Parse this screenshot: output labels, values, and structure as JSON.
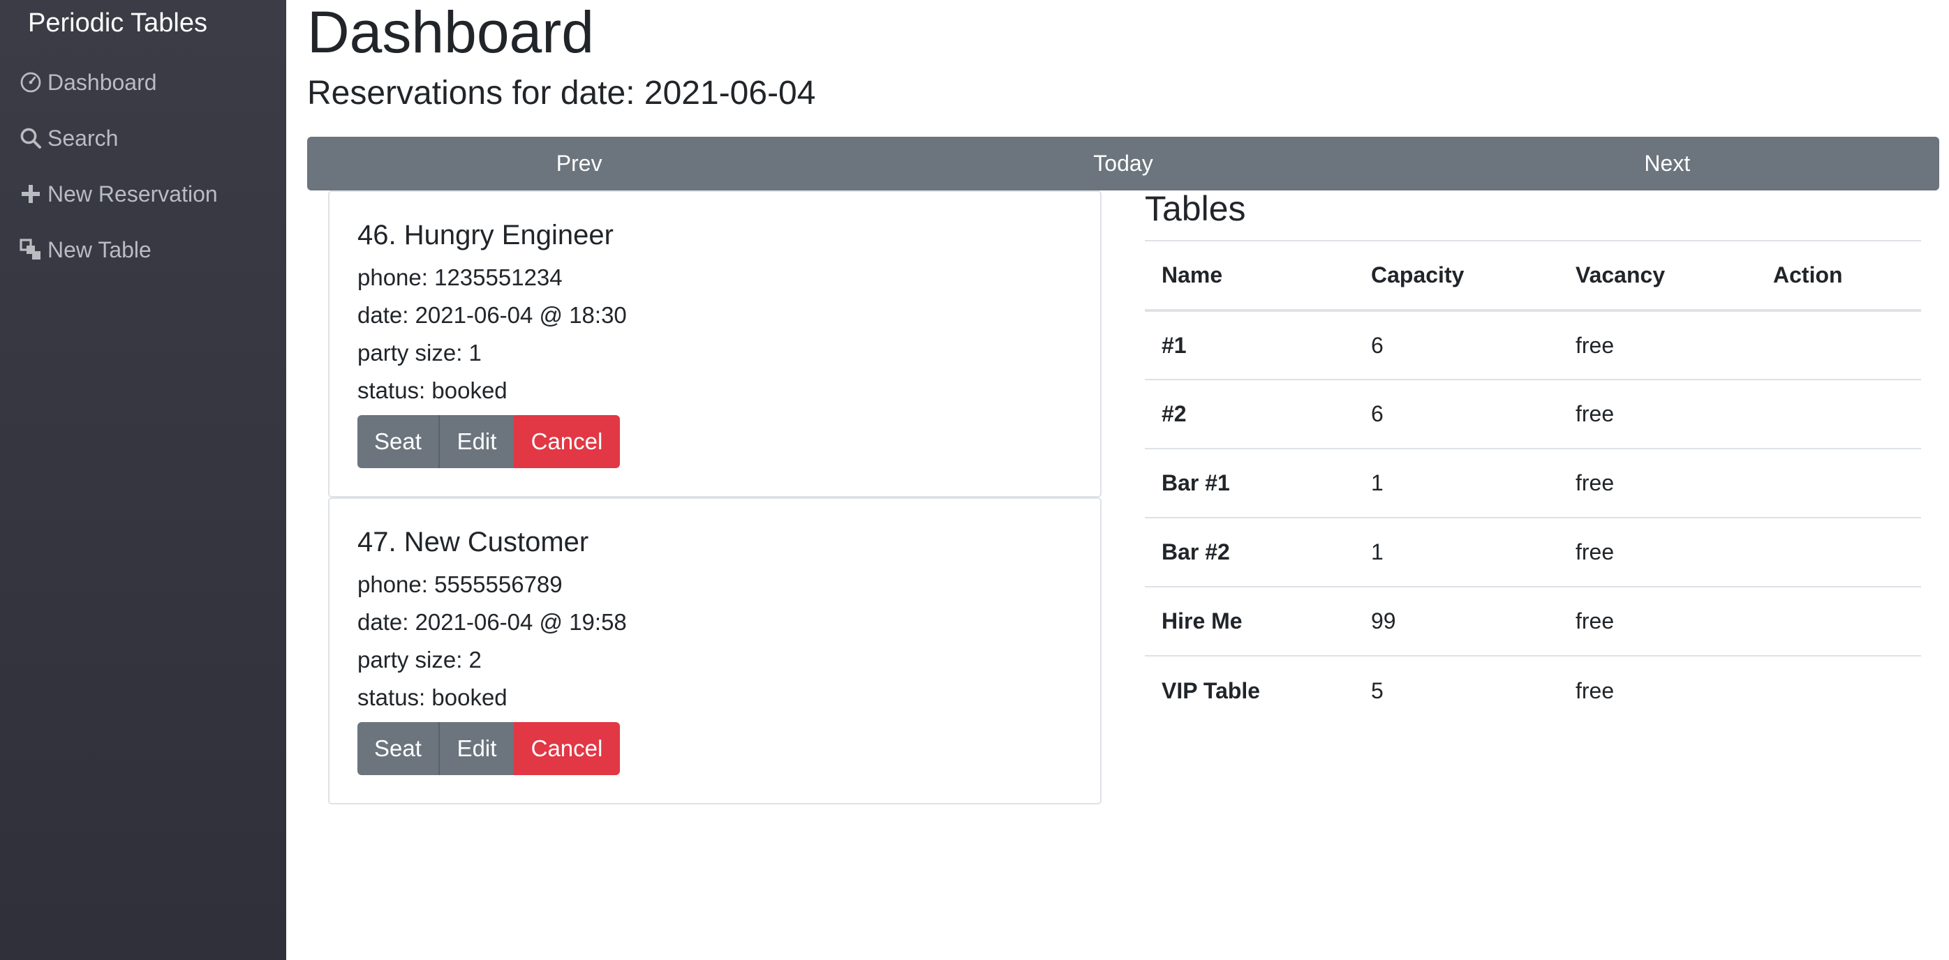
{
  "sidebar": {
    "brand": "Periodic Tables",
    "items": [
      {
        "label": "Dashboard",
        "icon": "dashboard-gauge-icon"
      },
      {
        "label": "Search",
        "icon": "search-icon"
      },
      {
        "label": "New Reservation",
        "icon": "plus-icon"
      },
      {
        "label": "New Table",
        "icon": "layers-icon"
      }
    ]
  },
  "header": {
    "title": "Dashboard",
    "subheading": "Reservations for date: 2021-06-04"
  },
  "date_nav": {
    "prev": "Prev",
    "today": "Today",
    "next": "Next"
  },
  "reservations": [
    {
      "title": "46. Hungry Engineer",
      "phone": "phone: 1235551234",
      "date": "date: 2021-06-04 @ 18:30",
      "party": "party size: 1",
      "status": "status: booked",
      "seat": "Seat",
      "edit": "Edit",
      "cancel": "Cancel"
    },
    {
      "title": "47. New Customer",
      "phone": "phone: 5555556789",
      "date": "date: 2021-06-04 @ 19:58",
      "party": "party size: 2",
      "status": "status: booked",
      "seat": "Seat",
      "edit": "Edit",
      "cancel": "Cancel"
    }
  ],
  "tables": {
    "title": "Tables",
    "columns": [
      "Name",
      "Capacity",
      "Vacancy",
      "Action"
    ],
    "rows": [
      {
        "name": "#1",
        "capacity": "6",
        "vacancy": "free",
        "action": ""
      },
      {
        "name": "#2",
        "capacity": "6",
        "vacancy": "free",
        "action": ""
      },
      {
        "name": "Bar #1",
        "capacity": "1",
        "vacancy": "free",
        "action": ""
      },
      {
        "name": "Bar #2",
        "capacity": "1",
        "vacancy": "free",
        "action": ""
      },
      {
        "name": "Hire Me",
        "capacity": "99",
        "vacancy": "free",
        "action": ""
      },
      {
        "name": "VIP Table",
        "capacity": "5",
        "vacancy": "free",
        "action": ""
      }
    ]
  },
  "colors": {
    "sidebar_bg": "#35363f",
    "secondary_button": "#6c757d",
    "danger_button": "#e23744"
  }
}
